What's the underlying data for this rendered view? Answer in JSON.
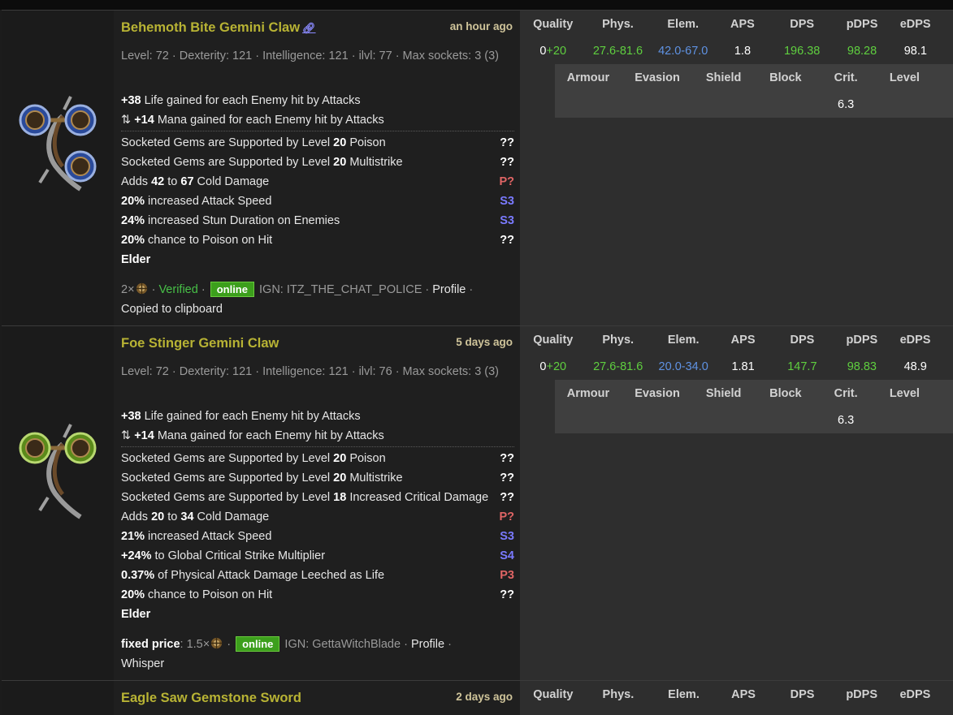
{
  "stat_headers": [
    "Quality",
    "Phys.",
    "Elem.",
    "APS",
    "DPS",
    "pDPS",
    "eDPS"
  ],
  "def_headers": [
    "Armour",
    "Evasion",
    "Shield",
    "Block",
    "Crit.",
    "Level"
  ],
  "results": [
    {
      "name": "Behemoth Bite Gemini Claw",
      "posted": "an hour ago",
      "requirements": "Level: 72 · Dexterity: 121 · Intelligence: 121 · ilvl: 77 · Max sockets: 3 (3)",
      "implicits": [
        {
          "pre": "",
          "num": "+38",
          "post": " Life gained for each Enemy hit by Attacks"
        },
        {
          "pre": "⇅ ",
          "num": "+14",
          "post": " Mana gained for each Enemy hit by Attacks"
        }
      ],
      "mods": [
        {
          "pre": "Socketed Gems are Supported by Level ",
          "num": "20",
          "post": " Poison",
          "tag": "??",
          "tagtype": "q"
        },
        {
          "pre": "Socketed Gems are Supported by Level ",
          "num": "20",
          "post": " Multistrike",
          "tag": "??",
          "tagtype": "q"
        },
        {
          "pre": "Adds ",
          "num": "42",
          "post": " to ",
          "num2": "67",
          "post2": " Cold Damage",
          "tag": "P?",
          "tagtype": "p"
        },
        {
          "pre": "",
          "num": "20%",
          "post": " increased Attack Speed",
          "tag": "S3",
          "tagtype": "s"
        },
        {
          "pre": "",
          "num": "24%",
          "post": " increased Stun Duration on Enemies",
          "tag": "S3",
          "tagtype": "s"
        },
        {
          "pre": "",
          "num": "20%",
          "post": " chance to Poison on Hit",
          "tag": "??",
          "tagtype": "q"
        }
      ],
      "influence": "Elder",
      "seller": {
        "count": "2×",
        "verified": "Verified",
        "status": "online",
        "ign": "IGN: ITZ_THE_CHAT_POLICE",
        "profile": "Profile",
        "copied": "Copied to clipboard"
      },
      "stats": {
        "quality_base": "0",
        "quality_bonus": "+20",
        "phys": "27.6-81.6",
        "elem": "42.0-67.0",
        "aps": "1.8",
        "dps": "196.38",
        "pdps": "98.28",
        "edps": "98.1"
      },
      "defence": {
        "armour": "",
        "evasion": "",
        "shield": "",
        "block": "",
        "crit": "6.3",
        "level": ""
      }
    },
    {
      "name": "Foe Stinger Gemini Claw",
      "posted": "5 days ago",
      "requirements": "Level: 72 · Dexterity: 121 · Intelligence: 121 · ilvl: 76 · Max sockets: 3 (3)",
      "implicits": [
        {
          "pre": "",
          "num": "+38",
          "post": " Life gained for each Enemy hit by Attacks"
        },
        {
          "pre": "⇅ ",
          "num": "+14",
          "post": " Mana gained for each Enemy hit by Attacks"
        }
      ],
      "mods": [
        {
          "pre": "Socketed Gems are Supported by Level ",
          "num": "20",
          "post": " Poison",
          "tag": "??",
          "tagtype": "q"
        },
        {
          "pre": "Socketed Gems are Supported by Level ",
          "num": "20",
          "post": " Multistrike",
          "tag": "??",
          "tagtype": "q"
        },
        {
          "pre": "Socketed Gems are Supported by Level ",
          "num": "18",
          "post": " Increased Critical Damage",
          "tag": "??",
          "tagtype": "q"
        },
        {
          "pre": "Adds ",
          "num": "20",
          "post": " to ",
          "num2": "34",
          "post2": " Cold Damage",
          "tag": "P?",
          "tagtype": "p"
        },
        {
          "pre": "",
          "num": "21%",
          "post": " increased Attack Speed",
          "tag": "S3",
          "tagtype": "s"
        },
        {
          "pre": "",
          "num": "+24%",
          "post": " to Global Critical Strike Multiplier",
          "tag": "S4",
          "tagtype": "s"
        },
        {
          "pre": "",
          "num": "0.37%",
          "post": " of Physical Attack Damage Leeched as Life",
          "tag": "P3",
          "tagtype": "p"
        },
        {
          "pre": "",
          "num": "20%",
          "post": " chance to Poison on Hit",
          "tag": "??",
          "tagtype": "q"
        }
      ],
      "influence": "Elder",
      "seller": {
        "price_label": "fixed price",
        "price_value": ": 1.5×",
        "status": "online",
        "ign": "IGN: GettaWitchBlade",
        "profile": "Profile",
        "whisper": "Whisper"
      },
      "stats": {
        "quality_base": "0",
        "quality_bonus": "+20",
        "phys": "27.6-81.6",
        "elem": "20.0-34.0",
        "aps": "1.81",
        "dps": "147.7",
        "pdps": "98.83",
        "edps": "48.9"
      },
      "defence": {
        "armour": "",
        "evasion": "",
        "shield": "",
        "block": "",
        "crit": "6.3",
        "level": ""
      }
    },
    {
      "name": "Eagle Saw Gemstone Sword",
      "posted": "2 days ago"
    }
  ],
  "colors": {
    "item_name": "#b8b334",
    "verified": "#47c047",
    "online_badge": "#3c9f1c",
    "tag_pseudo": "#e06565",
    "tag_suffix": "#7a7aff",
    "phys_value": "#5fcf3f",
    "elem_value": "#5f92e3"
  },
  "icons": {
    "item_1": "gemini-claw-blue-sockets-icon",
    "item_2": "gemini-claw-green-sockets-icon",
    "currency": "currency-orb-icon",
    "link": "link-icon",
    "swap": "swap-arrows-icon"
  }
}
